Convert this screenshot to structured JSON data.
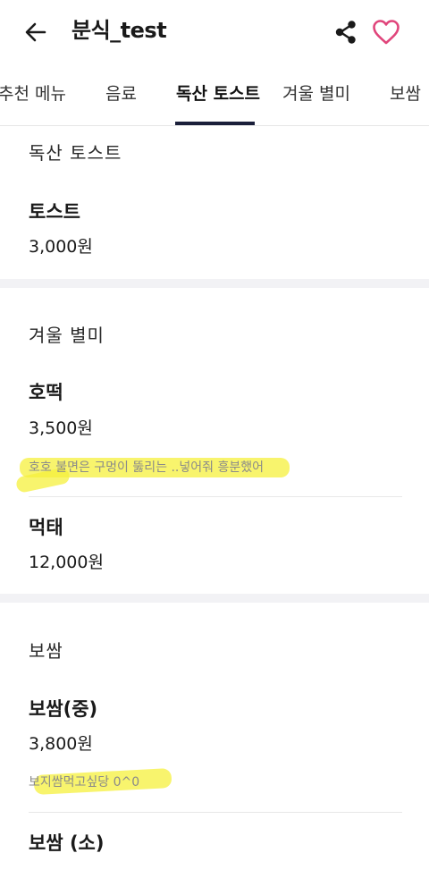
{
  "header": {
    "title": "분식_test",
    "back_icon": "arrow-left-icon",
    "share_icon": "share-icon",
    "favorite_icon": "heart-outline-icon",
    "favorite_color": "#e0457b"
  },
  "tabs": [
    {
      "label": "추천 메뉴",
      "active": false
    },
    {
      "label": "음료",
      "active": false
    },
    {
      "label": "독산 토스트",
      "active": true
    },
    {
      "label": "겨울 별미",
      "active": false
    },
    {
      "label": "보쌈",
      "active": false
    }
  ],
  "sections": [
    {
      "title": "독산 토스트",
      "items": [
        {
          "name": "토스트",
          "price": "3,000원"
        }
      ]
    },
    {
      "title": "겨울 별미",
      "items": [
        {
          "name": "호떡",
          "price": "3,500원",
          "description": "호호 불면은 구멍이 뚫리는 ..넣어줘 흥분했어"
        },
        {
          "name": "먹태",
          "price": "12,000원"
        }
      ]
    },
    {
      "title": "보쌈",
      "items": [
        {
          "name": "보쌈(중)",
          "price": "3,800원",
          "description": "보지쌈먹고싶당 0^0"
        },
        {
          "name": "보쌈 (소)"
        }
      ]
    }
  ],
  "colors": {
    "accent_underline": "#1a1f3a",
    "highlight": "#f6f03c",
    "section_gap": "#f2f2f5"
  }
}
